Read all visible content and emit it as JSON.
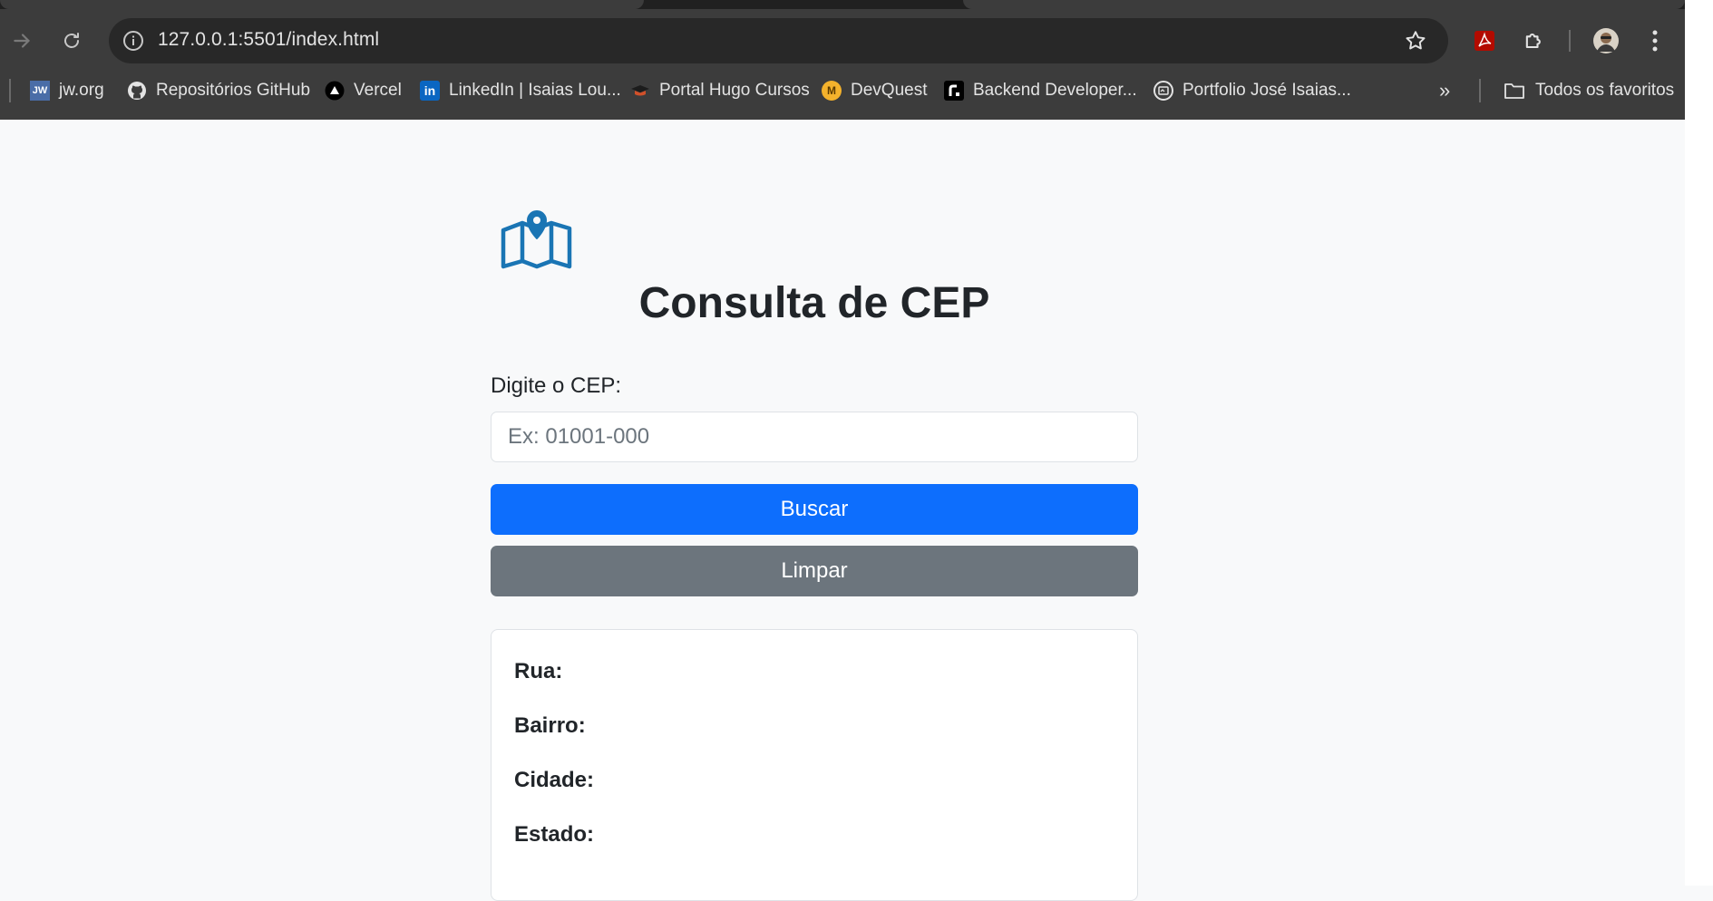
{
  "browser": {
    "url": "127.0.0.1:5501/index.html",
    "bookmarks": [
      {
        "label": "jw.org",
        "icon": "jw-icon"
      },
      {
        "label": "Repositórios GitHub",
        "icon": "github-icon"
      },
      {
        "label": "Vercel",
        "icon": "vercel-icon"
      },
      {
        "label": "LinkedIn | Isaias Lou...",
        "icon": "linkedin-icon"
      },
      {
        "label": "Portal Hugo Cursos",
        "icon": "graduation-cap-icon"
      },
      {
        "label": "DevQuest",
        "icon": "devquest-icon"
      },
      {
        "label": "Backend Developer...",
        "icon": "roadmap-icon"
      },
      {
        "label": "Portfolio José Isaias...",
        "icon": "portfolio-icon"
      }
    ],
    "more_bookmarks": "»",
    "all_bookmarks": "Todos os favoritos",
    "jw_badge": "JW",
    "linkedin_badge": "in",
    "devquest_badge": "M"
  },
  "page": {
    "title": "Consulta de CEP",
    "cep_label": "Digite o CEP:",
    "cep_placeholder": "Ex: 01001-000",
    "cep_value": "",
    "search_button": "Buscar",
    "clear_button": "Limpar",
    "result": {
      "street_label": "Rua:",
      "neighborhood_label": "Bairro:",
      "city_label": "Cidade:",
      "state_label": "Estado:"
    }
  },
  "colors": {
    "primary": "#0d6efd",
    "secondary": "#6c757d",
    "icon_blue": "#1a75b4",
    "page_bg": "#f8f9fa"
  }
}
